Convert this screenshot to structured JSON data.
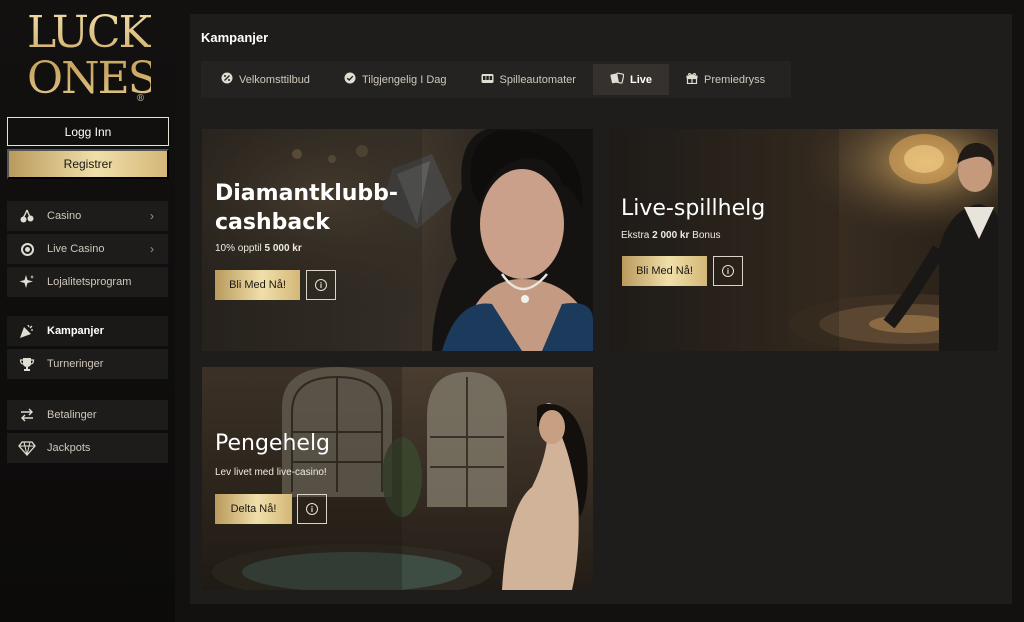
{
  "brand": {
    "logo_line1": "LUCKY",
    "logo_line2": "ONES",
    "logo_mark": "®"
  },
  "auth": {
    "login_label": "Logg Inn",
    "register_label": "Registrer"
  },
  "sidebar": {
    "items": [
      {
        "label": "Casino",
        "icon": "cherries-icon"
      },
      {
        "label": "Live Casino",
        "icon": "chip-icon"
      },
      {
        "label": "Lojalitetsprogram",
        "icon": "sparkle-icon"
      },
      {
        "label": "Kampanjer",
        "icon": "party-popper-icon"
      },
      {
        "label": "Turneringer",
        "icon": "trophy-icon"
      },
      {
        "label": "Betalinger",
        "icon": "transfer-arrows-icon"
      },
      {
        "label": "Jackpots",
        "icon": "diamond-icon"
      }
    ]
  },
  "page": {
    "title": "Kampanjer"
  },
  "tabs": [
    {
      "label": "Velkomsttilbud",
      "icon": "percent-badge-icon"
    },
    {
      "label": "Tilgjengelig I Dag",
      "icon": "check-badge-icon"
    },
    {
      "label": "Spilleautomater",
      "icon": "slot-machine-icon"
    },
    {
      "label": "Live",
      "icon": "cards-icon"
    },
    {
      "label": "Premiedryss",
      "icon": "gift-icon"
    }
  ],
  "promos": [
    {
      "title": "Diamantklubb-cashback",
      "sub_prefix": "10% opptil ",
      "sub_bold": "5 000 kr",
      "sub_suffix": "",
      "cta": "Bli Med Nå!",
      "info": "i"
    },
    {
      "title": "Live-spillhelg",
      "sub_prefix": "Ekstra ",
      "sub_bold": "2 000 kr",
      "sub_suffix": " Bonus",
      "cta": "Bli Med Nå!",
      "info": "i"
    },
    {
      "title": "Pengehelg",
      "sub_prefix": "Lev livet med live-casino!",
      "sub_bold": "",
      "sub_suffix": "",
      "cta": "Delta Nå!",
      "info": "i"
    }
  ],
  "colors": {
    "gold_accent": "#d9c08a",
    "panel_bg": "#1f1d1b",
    "sidebar_item_bg": "#1d1c1a",
    "active_tab_bg": "#35322e"
  }
}
